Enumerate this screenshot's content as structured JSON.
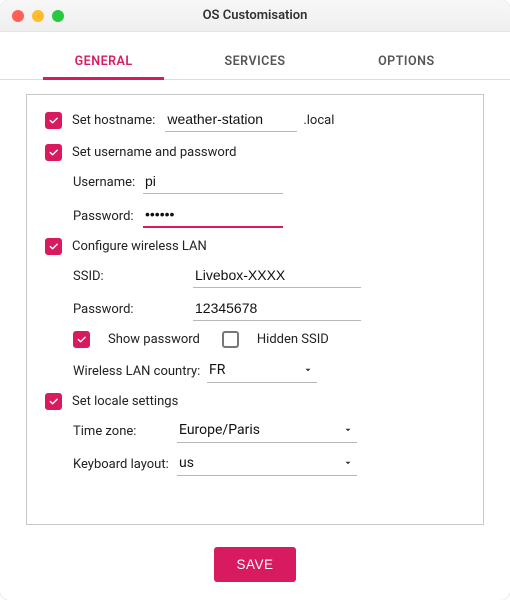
{
  "window": {
    "title": "OS Customisation"
  },
  "tabs": {
    "general": "GENERAL",
    "services": "SERVICES",
    "options": "OPTIONS"
  },
  "hostname": {
    "label": "Set hostname:",
    "value": "weather-station",
    "suffix": ".local"
  },
  "userpass": {
    "label": "Set username and password",
    "username_label": "Username:",
    "username_value": "pi",
    "password_label": "Password:",
    "password_value": "••••••"
  },
  "wifi": {
    "label": "Configure wireless LAN",
    "ssid_label": "SSID:",
    "ssid_value": "Livebox-XXXX",
    "password_label": "Password:",
    "password_value": "12345678",
    "show_password_label": "Show password",
    "hidden_ssid_label": "Hidden SSID",
    "country_label": "Wireless LAN country:",
    "country_value": "FR"
  },
  "locale": {
    "label": "Set locale settings",
    "timezone_label": "Time zone:",
    "timezone_value": "Europe/Paris",
    "keyboard_label": "Keyboard layout:",
    "keyboard_value": "us"
  },
  "footer": {
    "save": "SAVE"
  },
  "colors": {
    "accent": "#d81b60"
  }
}
